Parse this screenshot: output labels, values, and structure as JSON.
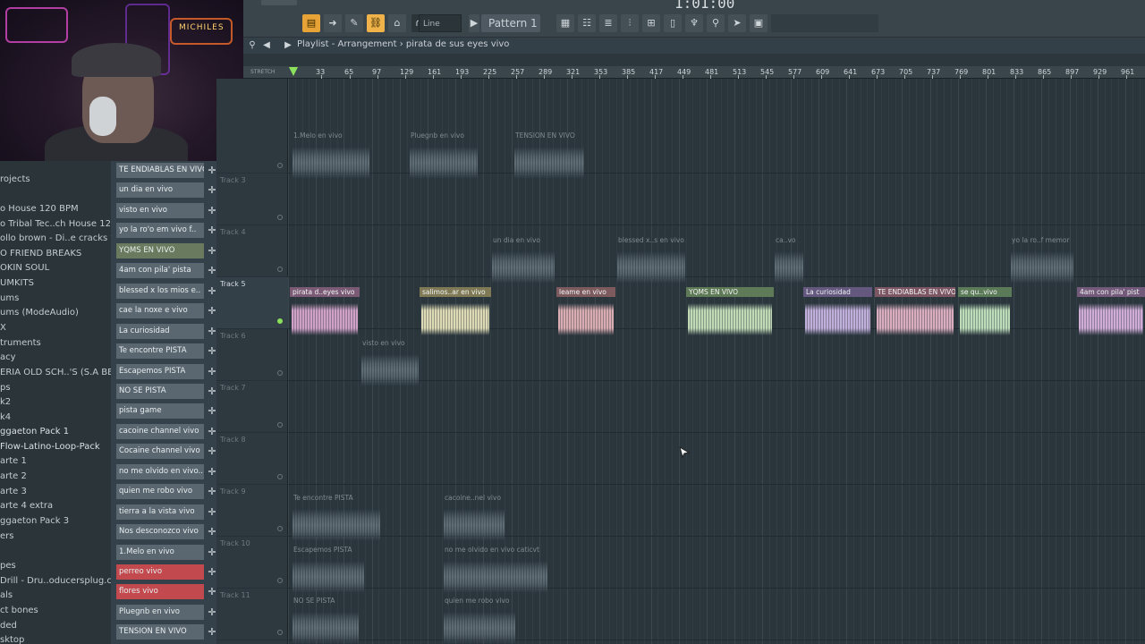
{
  "toolbar": {
    "time": "1:01:00",
    "line_mode": "Line",
    "pattern": "Pattern 1"
  },
  "playlist": {
    "title": "Playlist - Arrangement › pirata de sus eyes vivo",
    "stretch_label": "STRETCH"
  },
  "ruler": {
    "ticks": [
      "33",
      "65",
      "97",
      "129",
      "161",
      "193",
      "225",
      "257",
      "289",
      "321",
      "353",
      "385",
      "417",
      "449",
      "481",
      "513",
      "545",
      "577",
      "609",
      "641",
      "673",
      "705",
      "737",
      "769",
      "801",
      "833",
      "865",
      "897",
      "929",
      "961"
    ]
  },
  "browser": {
    "items": [
      "rojects",
      "o House 120 BPM",
      "o Tribal Tec..ch House 126BPM",
      "ollo brown - Di..e cracks vol. 2",
      "O FRIEND BREAKS",
      "OKIN SOUL",
      "UMKITS",
      "ums",
      "ums (ModeAudio)",
      "X",
      "truments",
      "acy",
      "ERIA OLD SCH..'S (S.A BEATS)",
      "ps",
      "k2",
      "k4",
      "ggaeton Pack 1",
      "Flow-Latino-Loop-Pack",
      "arte 1",
      "arte 2",
      "arte 3",
      "arte 4 extra",
      "ggaeton Pack 3",
      "ers",
      "",
      "pes",
      "Drill - Dru..oducersplug.com]",
      "als",
      "ct bones",
      "ded",
      "sktop"
    ]
  },
  "picker": {
    "items": [
      {
        "label": "TE ENDIABLAS EN VIVO",
        "style": "normal"
      },
      {
        "label": "un dia en vivo",
        "style": "normal"
      },
      {
        "label": "visto en vivo",
        "style": "normal"
      },
      {
        "label": "yo la ro'o em vivo f..",
        "style": "normal"
      },
      {
        "label": "YQMS EN VIVO",
        "style": "green"
      },
      {
        "label": "4am con pila' pista",
        "style": "normal"
      },
      {
        "label": "blessed x los mios e..",
        "style": "normal"
      },
      {
        "label": "cae la noxe e vivo",
        "style": "normal"
      },
      {
        "label": "La curiosidad",
        "style": "normal"
      },
      {
        "label": "Te encontre PISTA",
        "style": "normal"
      },
      {
        "label": "Escapemos PISTA",
        "style": "normal"
      },
      {
        "label": "NO SE PISTA",
        "style": "normal"
      },
      {
        "label": "pista game",
        "style": "normal"
      },
      {
        "label": "cacoine channel vivo",
        "style": "normal"
      },
      {
        "label": "Cocaine channel vivo",
        "style": "normal"
      },
      {
        "label": "no me olvido en vivo..",
        "style": "normal"
      },
      {
        "label": "quien me robo vivo",
        "style": "normal"
      },
      {
        "label": "tierra a la vista vivo",
        "style": "normal"
      },
      {
        "label": "Nos desconozco vivo",
        "style": "normal"
      },
      {
        "label": "1.Melo en vivo",
        "style": "normal"
      },
      {
        "label": "perreo vivo",
        "style": "red"
      },
      {
        "label": "flores vivo",
        "style": "red"
      },
      {
        "label": "Pluegnb en vivo",
        "style": "normal"
      },
      {
        "label": "TENSION EN VIVO",
        "style": "normal"
      }
    ]
  },
  "tracks": [
    {
      "name": ""
    },
    {
      "name": "Track 3"
    },
    {
      "name": "Track 4"
    },
    {
      "name": "Track 5"
    },
    {
      "name": "Track 6"
    },
    {
      "name": "Track 7"
    },
    {
      "name": "Track 8"
    },
    {
      "name": "Track 9"
    },
    {
      "name": "Track 10"
    },
    {
      "name": "Track 11"
    }
  ],
  "clips": [
    {
      "label": "1.Melo en vivo",
      "kind": "ghost",
      "color": "#6a7880"
    },
    {
      "label": "Pluegnb en vivo",
      "kind": "ghost",
      "color": "#6a7880"
    },
    {
      "label": "TENSION EN VIVO",
      "kind": "ghost",
      "color": "#6a7880"
    },
    {
      "label": "un dia en vivo",
      "kind": "ghost",
      "color": "#6a7880"
    },
    {
      "label": "blessed x..s en vivo",
      "kind": "ghost",
      "color": "#6a7880"
    },
    {
      "label": "ca..vo",
      "kind": "ghost",
      "color": "#6a7880"
    },
    {
      "label": "yo la ro..f memor",
      "kind": "ghost",
      "color": "#6a7880"
    },
    {
      "label": "pirata d..eyes vivo",
      "kind": "solid",
      "color": "#d9a7cf",
      "head": "#7a5a74"
    },
    {
      "label": "salimos..ar en vivo",
      "kind": "solid",
      "color": "#e7e2bb",
      "head": "#7f7a55"
    },
    {
      "label": "leame en vivo",
      "kind": "solid",
      "color": "#e3b3b8",
      "head": "#7d5a5e"
    },
    {
      "label": "YQMS EN VIVO",
      "kind": "solid",
      "color": "#c9e3bd",
      "head": "#5f7a56"
    },
    {
      "label": "La curiosidad",
      "kind": "solid",
      "color": "#c9b6e3",
      "head": "#65587f"
    },
    {
      "label": "TE ENDIABLAS EN VIVO",
      "kind": "solid",
      "color": "#e4b4c6",
      "head": "#7d5664"
    },
    {
      "label": "se qu..vivo",
      "kind": "solid",
      "color": "#c5e6c1",
      "head": "#5b7a57"
    },
    {
      "label": "4am con pila' pist",
      "kind": "solid",
      "color": "#d9b3e0",
      "head": "#735a7a"
    },
    {
      "label": "visto en vivo",
      "kind": "ghost",
      "color": "#6a7880"
    },
    {
      "label": "Te encontre PISTA",
      "kind": "ghost",
      "color": "#6a7880"
    },
    {
      "label": "cacoine..nel vivo",
      "kind": "ghost",
      "color": "#6a7880"
    },
    {
      "label": "Escapemos PISTA",
      "kind": "ghost",
      "color": "#6a7880"
    },
    {
      "label": "no me olvido en vivo caticvt",
      "kind": "ghost",
      "color": "#6a7880"
    },
    {
      "label": "NO SE PISTA",
      "kind": "ghost",
      "color": "#6a7880"
    },
    {
      "label": "quien me robo vivo",
      "kind": "ghost",
      "color": "#6a7880"
    }
  ],
  "webcam": {
    "sign_text": "MICHILES"
  }
}
